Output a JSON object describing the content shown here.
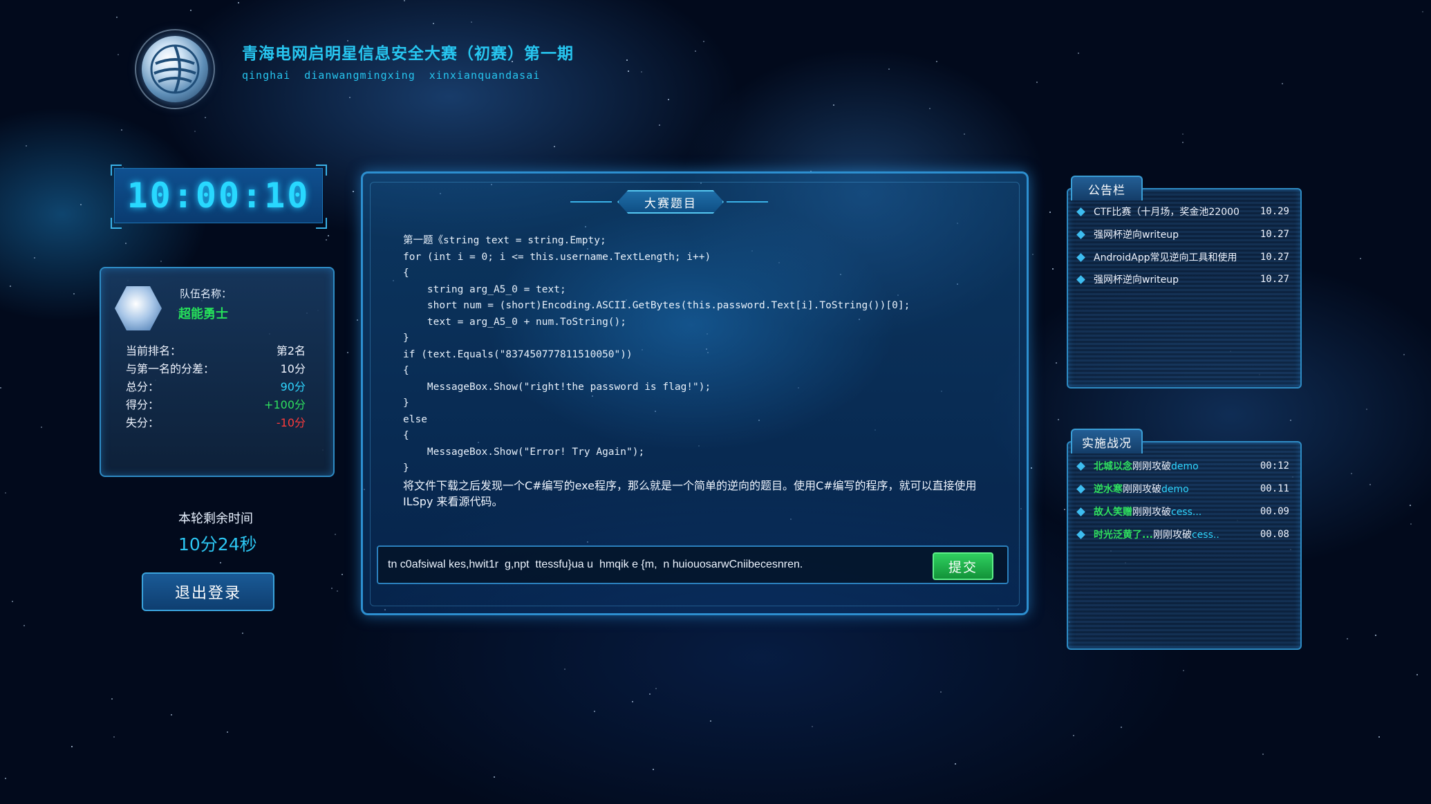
{
  "header": {
    "title": "青海电网启明星信息安全大赛（初赛）第一期",
    "subtitle": "qinghai dianwangmingxing xinxianquandasai"
  },
  "clock": {
    "time": "10:00:10"
  },
  "team": {
    "label": "队伍名称：",
    "name": "超能勇士",
    "stats": [
      {
        "label": "当前排名：",
        "value": "第2名",
        "color": "#f0f5ff"
      },
      {
        "label": "与第一名的分差：",
        "value": "10分",
        "color": "#f0f5ff"
      },
      {
        "label": "总分：",
        "value": "90分",
        "color": "#2fd6ff"
      },
      {
        "label": "得分：",
        "value": "+100分",
        "color": "#2fe05e"
      },
      {
        "label": "失分：",
        "value": "-10分",
        "color": "#ff3b3b"
      }
    ]
  },
  "timer": {
    "label": "本轮剩余时间",
    "value": "10分24秒"
  },
  "logout_label": "退出登录",
  "main": {
    "title": "大赛题目",
    "code": "第一题《string text = string.Empty;\nfor (int i = 0; i <= this.username.TextLength; i++)\n{\n    string arg_A5_0 = text;\n    short num = (short)Encoding.ASCII.GetBytes(this.password.Text[i].ToString())[0];\n    text = arg_A5_0 + num.ToString();\n}\nif (text.Equals(\"837450777811510050\"))\n{\n    MessageBox.Show(\"right!the password is flag!\");\n}\nelse\n{\n    MessageBox.Show(\"Error! Try Again\");\n}",
    "description": "将文件下载之后发现一个C#编写的exe程序，那么就是一个简单的逆向的题目。使用C#编写的程序，就可以直接使用 ILSpy 来看源代码。",
    "answer_value": "tn c0afsiwal kes,hwit1r  g,npt  ttessfu}ua u  hmqik e {m,  n huiouosarwCniibecesnren.",
    "submit_label": "提交"
  },
  "notice": {
    "title": "公告栏",
    "items": [
      {
        "text": "CTF比赛（十月场，奖金池22000",
        "date": "10.29"
      },
      {
        "text": "强网杯逆向writeup",
        "date": "10.27"
      },
      {
        "text": "AndroidApp常见逆向工具和使用",
        "date": "10.27"
      },
      {
        "text": "强网杯逆向writeup",
        "date": "10.27"
      }
    ]
  },
  "battle": {
    "title": "实施战况",
    "items": [
      {
        "team": "北城以念",
        "action": "刚刚攻破",
        "target": "demo",
        "time": "00:12"
      },
      {
        "team": "逆水寒",
        "action": "刚刚攻破",
        "target": "demo",
        "time": "00.11"
      },
      {
        "team": "故人笑赠",
        "action": "刚刚攻破",
        "target": "cess...",
        "time": "00.09"
      },
      {
        "team": "时光泛黄了...",
        "action": "刚刚攻破",
        "target": "cess..",
        "time": "00.08"
      }
    ]
  },
  "colors": {
    "accent": "#27c6f0",
    "border": "#2e8bc4",
    "green": "#2fe05e",
    "red": "#ff3b3b"
  }
}
